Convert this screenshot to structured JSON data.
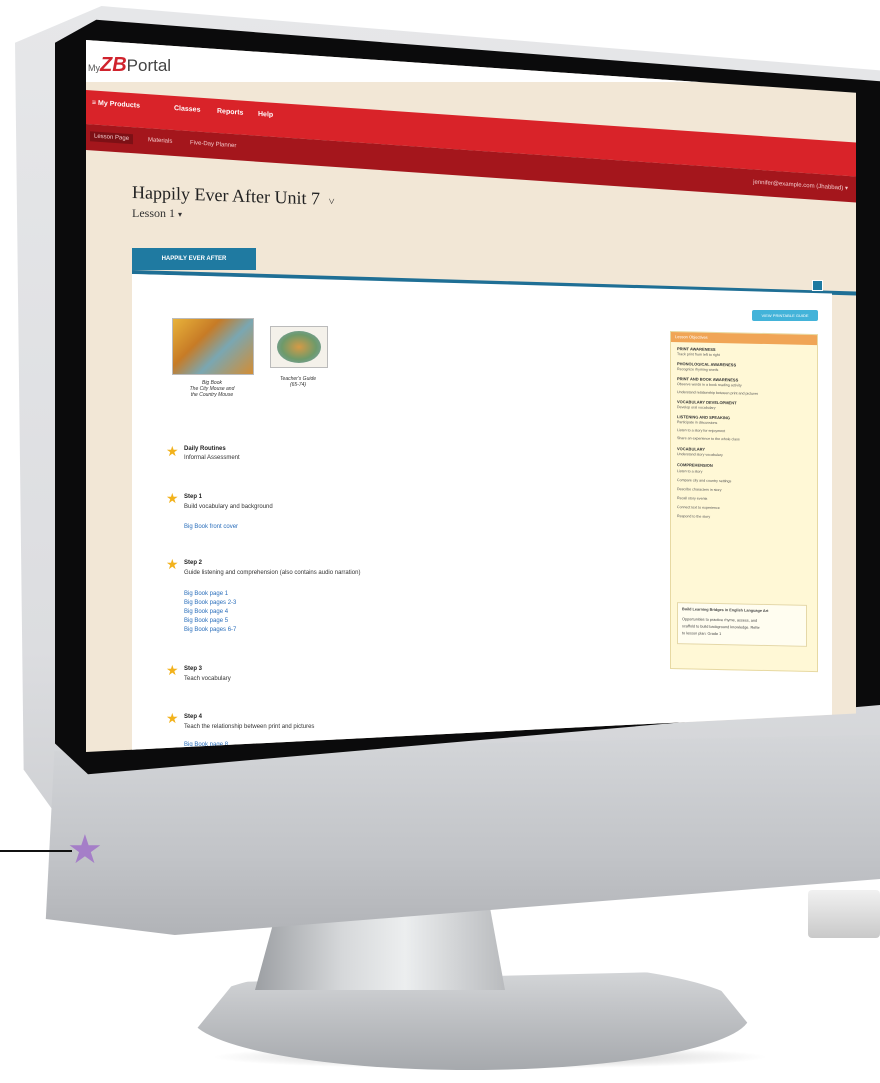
{
  "portal": {
    "logo_my": "My",
    "logo_zb": "ZB",
    "logo_portal": "Portal"
  },
  "nav": {
    "items": [
      "≡ My Products",
      "Classes",
      "Reports",
      "Help"
    ]
  },
  "subnav": {
    "items": [
      "Lesson Page",
      "Materials",
      "Five-Day Planner"
    ],
    "user_email": "jennifer@example.com (Jhabbad) ▾"
  },
  "lesson": {
    "unit_title": "Happily Ever After Unit 7",
    "unit_chevron": "˅",
    "lesson_label": "Lesson 1",
    "lesson_chevron": "▾",
    "tab_label": "HAPPILY EVER AFTER",
    "print_label": "VIEW PRINTABLE GUIDE"
  },
  "resources": [
    {
      "caption_1": "Big Book",
      "caption_2": "The City Mouse and",
      "caption_3": "the Country Mouse"
    },
    {
      "caption_1": "Teacher's Guide",
      "caption_2": "(65-74)",
      "caption_3": ""
    }
  ],
  "steps": [
    {
      "title": "Daily Routines",
      "desc": "Informal Assessment",
      "links": []
    },
    {
      "title": "Step 1",
      "desc": "Build vocabulary and background",
      "links": [
        "Big Book front cover"
      ]
    },
    {
      "title": "Step 2",
      "desc": "Guide listening and comprehension (also contains audio narration)",
      "links": [
        "Big Book page 1",
        "Big Book pages 2-3",
        "Big Book page 4",
        "Big Book page 5",
        "Big Book pages 6-7"
      ]
    },
    {
      "title": "Step 3",
      "desc": "Teach vocabulary",
      "links": []
    },
    {
      "title": "Step 4",
      "desc": "Teach the relationship between print and pictures",
      "links": [
        "Big Book page 8"
      ]
    }
  ],
  "objectives": {
    "header": "Lesson Objectives",
    "sections": [
      {
        "head": "PRINT AWARENESS",
        "lines": [
          "Track print from left to right"
        ]
      },
      {
        "head": "PHONOLOGICAL AWARENESS",
        "lines": [
          "Recognize rhyming words"
        ]
      },
      {
        "head": "PRINT AND BOOK AWARENESS",
        "lines": [
          "Observe words in a book reading activity",
          "Understand relationship between print and pictures"
        ]
      },
      {
        "head": "VOCABULARY DEVELOPMENT",
        "lines": [
          "Develop oral vocabulary"
        ]
      },
      {
        "head": "LISTENING AND SPEAKING",
        "lines": [
          "Participate in discussions",
          "Listen to a story for enjoyment",
          "Share an experience to the whole class"
        ]
      },
      {
        "head": "VOCABULARY",
        "lines": [
          "Understand story vocabulary"
        ]
      },
      {
        "head": "COMPREHENSION",
        "lines": [
          "Listen to a story",
          "Compare city and country settings",
          "Describe characters in story",
          "Recall story events",
          "Connect text to experience",
          "Respond to the story"
        ]
      }
    ],
    "note_title": "Build Learning Bridges in English Language Art",
    "note_lines": [
      "Opportunities to practice rhyme, assess, and",
      "scaffold to build background knowledge. Refer",
      "to lesson plan: Grade 1"
    ]
  }
}
